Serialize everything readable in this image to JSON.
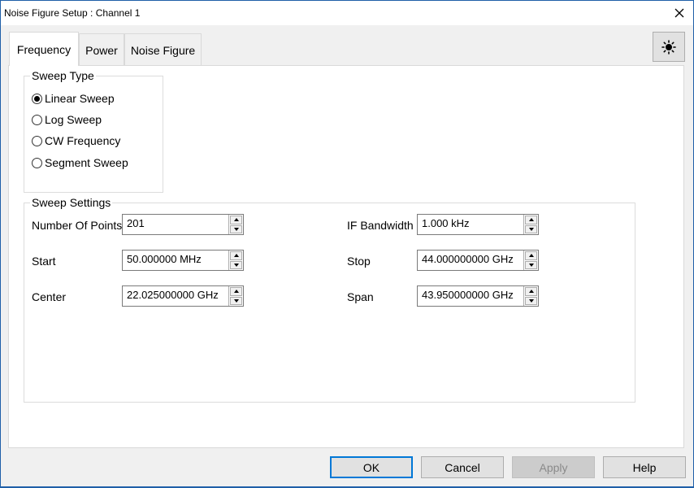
{
  "window": {
    "title": "Noise Figure Setup : Channel 1",
    "close_icon": "close-icon"
  },
  "tabs": [
    {
      "label": "Frequency",
      "active": true
    },
    {
      "label": "Power",
      "active": false
    },
    {
      "label": "Noise Figure",
      "active": false
    }
  ],
  "theme_button": {
    "icon": "brightness-icon"
  },
  "sweep_type": {
    "title": "Sweep Type",
    "options": [
      {
        "label": "Linear Sweep",
        "checked": true
      },
      {
        "label": "Log Sweep",
        "checked": false
      },
      {
        "label": "CW Frequency",
        "checked": false
      },
      {
        "label": "Segment Sweep",
        "checked": false
      }
    ]
  },
  "sweep_settings": {
    "title": "Sweep Settings",
    "number_of_points": {
      "label": "Number Of Points",
      "value": "201"
    },
    "if_bandwidth": {
      "label": "IF Bandwidth",
      "value": "1.000 kHz"
    },
    "start": {
      "label": "Start",
      "value": "50.000000 MHz"
    },
    "stop": {
      "label": "Stop",
      "value": "44.000000000 GHz"
    },
    "center": {
      "label": "Center",
      "value": "22.025000000 GHz"
    },
    "span": {
      "label": "Span",
      "value": "43.950000000 GHz"
    }
  },
  "buttons": {
    "ok": "OK",
    "cancel": "Cancel",
    "apply": "Apply",
    "help": "Help"
  },
  "colors": {
    "window_border": "#1f5fa8",
    "default_button_border": "#0078d7",
    "disabled_text": "#8a8a8a"
  }
}
